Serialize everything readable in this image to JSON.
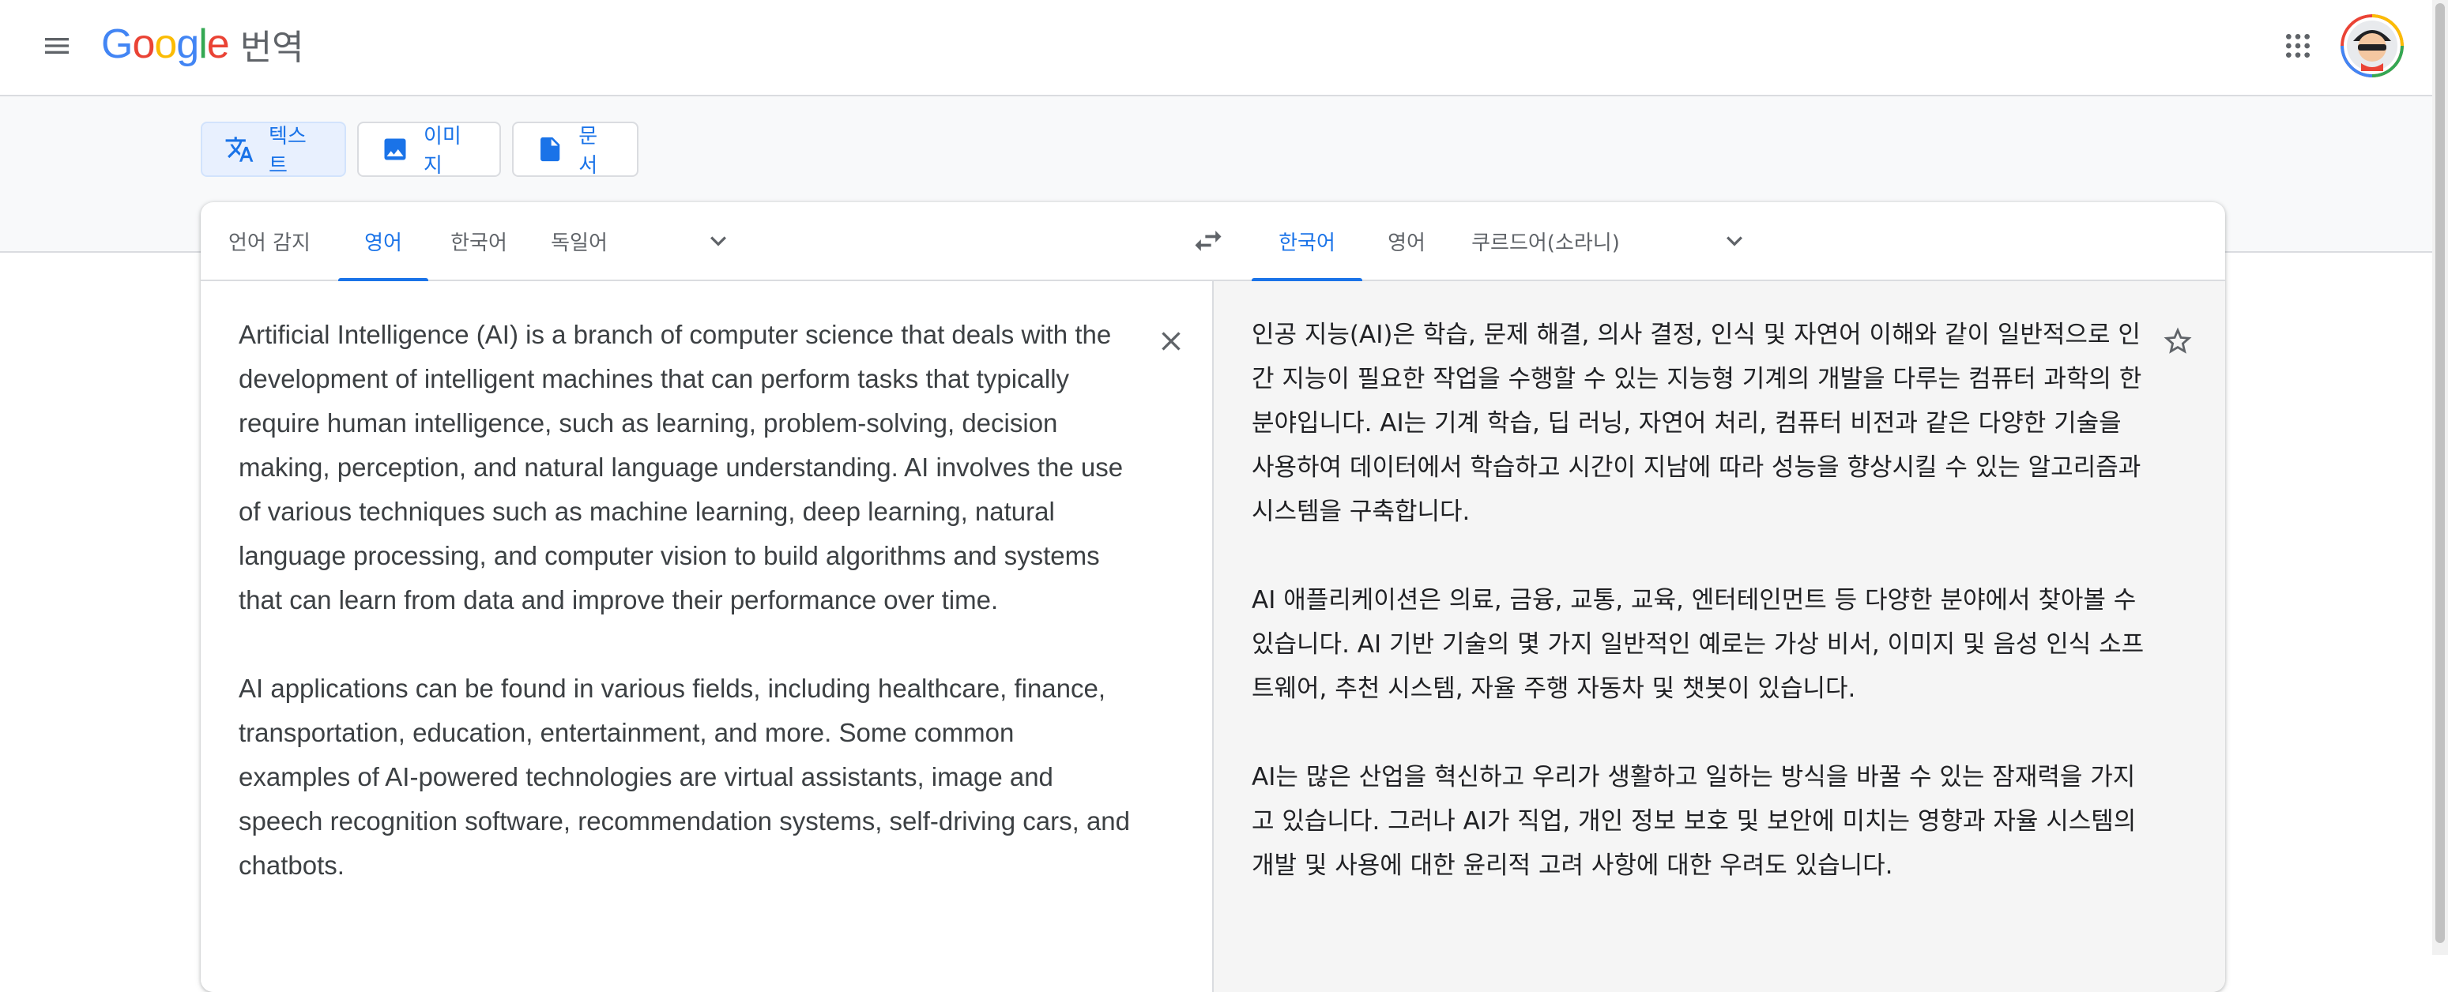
{
  "header": {
    "logo_text": "Google",
    "product": "번역",
    "menu_icon": "hamburger-menu-icon",
    "apps_icon": "apps-grid-icon",
    "avatar_icon": "user-avatar"
  },
  "colors": {
    "accent": "#1a73e8",
    "google_blue": "#4285f4",
    "google_red": "#ea4335",
    "google_yellow": "#fbbc04",
    "google_green": "#34a853"
  },
  "modes": [
    {
      "label": "텍스트",
      "icon": "translate-icon",
      "active": true
    },
    {
      "label": "이미지",
      "icon": "image-icon",
      "active": false
    },
    {
      "label": "문서",
      "icon": "document-icon",
      "active": false
    }
  ],
  "source_langs": {
    "tabs": [
      "언어 감지",
      "영어",
      "한국어",
      "독일어"
    ],
    "active": "영어"
  },
  "target_langs": {
    "tabs": [
      "한국어",
      "영어",
      "쿠르드어(소라니)"
    ],
    "active": "한국어"
  },
  "source_text": [
    "Artificial Intelligence (AI) is a branch of computer science that deals with the development of intelligent machines that can perform tasks that typically require human intelligence, such as learning, problem-solving, decision making, perception, and natural language understanding. AI involves the use of various techniques such as machine learning, deep learning, natural language processing, and computer vision to build algorithms and systems that can learn from data and improve their performance over time.",
    "AI applications can be found in various fields, including healthcare, finance, transportation, education, entertainment, and more. Some common examples of AI-powered technologies are virtual assistants, image and speech recognition software, recommendation systems, self-driving cars, and chatbots."
  ],
  "translated_text": [
    "인공 지능(AI)은 학습, 문제 해결, 의사 결정, 인식 및 자연어 이해와 같이 일반적으로 인간 지능이 필요한 작업을 수행할 수 있는 지능형 기계의 개발을 다루는 컴퓨터 과학의 한 분야입니다. AI는 기계 학습, 딥 러닝, 자연어 처리, 컴퓨터 비전과 같은 다양한 기술을 사용하여 데이터에서 학습하고 시간이 지남에 따라 성능을 향상시킬 수 있는 알고리즘과 시스템을 구축합니다.",
    "AI 애플리케이션은 의료, 금융, 교통, 교육, 엔터테인먼트 등 다양한 분야에서 찾아볼 수 있습니다. AI 기반 기술의 몇 가지 일반적인 예로는 가상 비서, 이미지 및 음성 인식 소프트웨어, 추천 시스템, 자율 주행 자동차 및 챗봇이 있습니다.",
    "AI는 많은 산업을 혁신하고 우리가 생활하고 일하는 방식을 바꿀 수 있는 잠재력을 가지고 있습니다. 그러나 AI가 직업, 개인 정보 보호 및 보안에 미치는 영향과 자율 시스템의 개발 및 사용에 대한 윤리적 고려 사항에 대한 우려도 있습니다."
  ],
  "icons": {
    "swap": "swap-languages-icon",
    "clear": "close-icon",
    "star": "star-outline-icon",
    "more_source": "chevron-down-icon",
    "more_target": "chevron-down-icon"
  }
}
